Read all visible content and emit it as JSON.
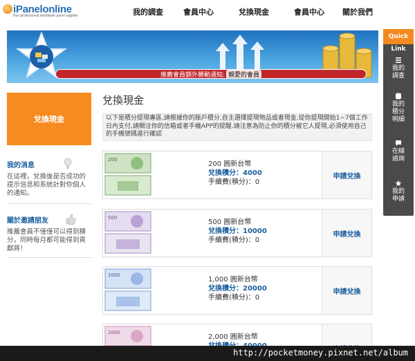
{
  "brand": {
    "logo_text": "iPanelonline",
    "logo_tagline": "Your professional worldwide panel supplier"
  },
  "nav": {
    "items": [
      "我的調查",
      "會員中心",
      "兌換現金",
      "會員中心",
      "關於我們"
    ]
  },
  "banner": {
    "ticker_label": "推薦會員額外勝動通知:",
    "ticker_highlight": "親愛的會員"
  },
  "sidebar": {
    "cta": "兌換現金",
    "messages_title": "我的消息",
    "messages_text": "在這裡，兌換後是否成功的提示信息和系統計對你個人的通知。",
    "invite_title": "關於邀請朋友",
    "invite_text": "推薦會員不僅僅可以得到積分，同時每月都可能得到貢獻將！"
  },
  "main": {
    "title": "兌換現金",
    "intro": "以下是積分提現專區,請根據你的賬戶積分,自主選擇提現物品或者現金,從你提現開始1~7個工作日內支付,請關注你的信箱或者手機APP的提醒.請注意為防止你的積分被它人提現,必須使用自己的手機號碼進行確認",
    "offers": [
      {
        "amount": "200 圓新台幣",
        "points_label": "兌換積分：4000",
        "fee_label": "手續費(積分)：0",
        "apply": "申請兌換"
      },
      {
        "amount": "500 圓新台幣",
        "points_label": "兌換積分：10000",
        "fee_label": "手續費(積分)：0",
        "apply": "申請兌換"
      },
      {
        "amount": "1,000 圓新台幣",
        "points_label": "兌換積分：20000",
        "fee_label": "手續費(積分)：0",
        "apply": "申請兌換"
      },
      {
        "amount": "2,000 圓新台幣",
        "points_label": "兌換積分：40000",
        "fee_label": "",
        "apply": "申請兌換"
      }
    ]
  },
  "quick": {
    "head": "Quick",
    "link": "Link",
    "items": [
      "我的調查",
      "我的積分明細",
      "在線諮詢",
      "我的申請"
    ]
  },
  "watermark": "http://pocketmoney.pixnet.net/album",
  "colors": {
    "accent_orange": "#f68b1f",
    "link_blue": "#1b5f9e",
    "ticker_red": "#c0262a",
    "note_green": "#7aa86a",
    "note_purple": "#a58bc4",
    "note_blue": "#7a9fd6",
    "note_pink": "#c98bb5"
  }
}
